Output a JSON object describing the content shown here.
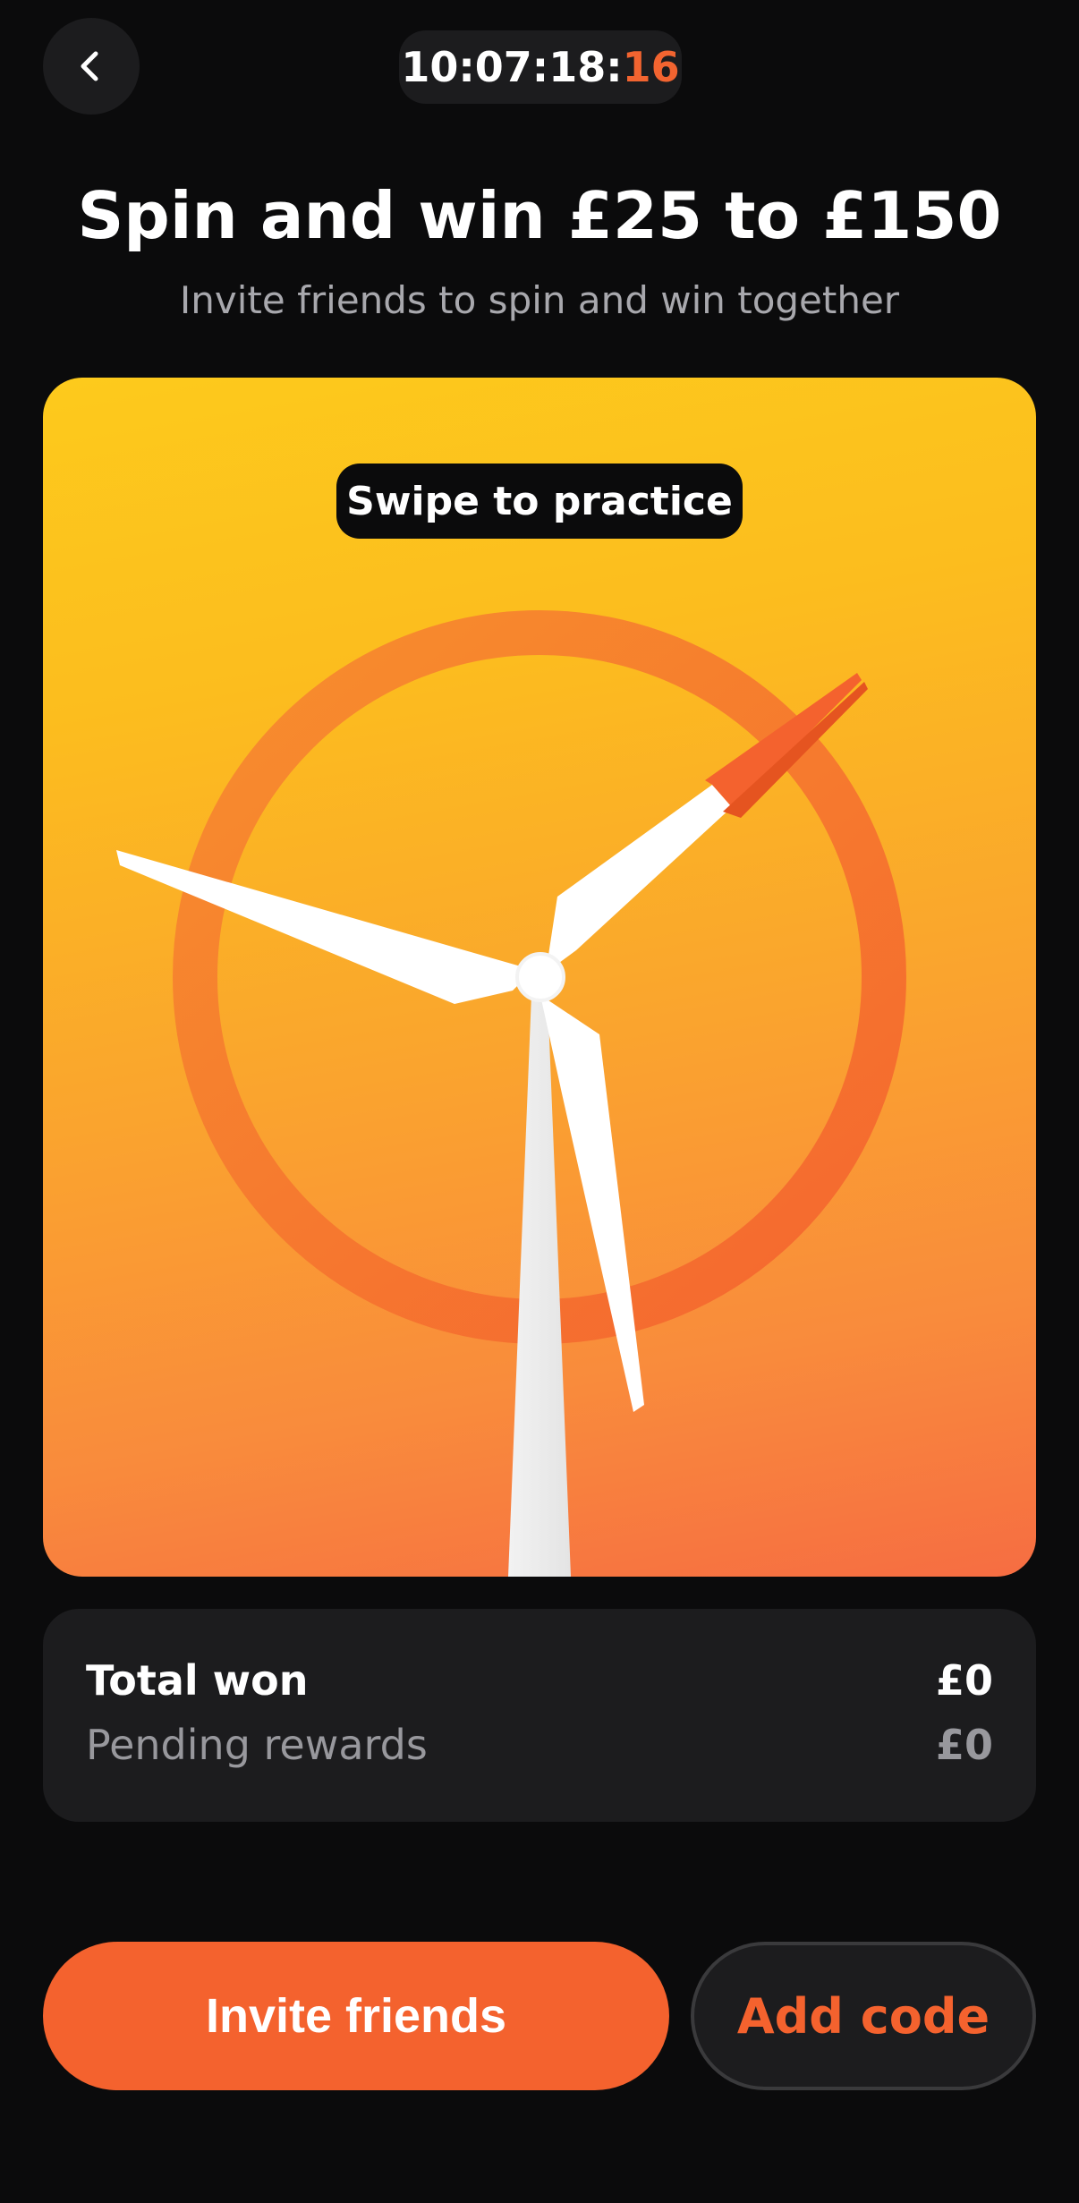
{
  "header": {
    "back_icon": "chevron-left-icon",
    "timer_main": "10:07:18:",
    "timer_seconds": "16"
  },
  "title": "Spin and win £25 to £150",
  "subtitle": "Invite friends to spin and win together",
  "hero": {
    "practice_label": "Swipe to practice",
    "illustration": "wind-turbine-icon",
    "colors": {
      "gradient_top": "#fdca1c",
      "gradient_bottom": "#f66d42",
      "ring": "#f4622e",
      "blade": "#ffffff"
    }
  },
  "stats": {
    "total_label": "Total won",
    "total_value": "£0",
    "pending_label": "Pending rewards",
    "pending_value": "£0"
  },
  "actions": {
    "invite_label": "Invite friends",
    "add_code_label": "Add code"
  },
  "colors": {
    "accent": "#f4622e",
    "background": "#0b0b0c",
    "card": "#1c1c1e",
    "muted_text": "#a8a8ad"
  }
}
